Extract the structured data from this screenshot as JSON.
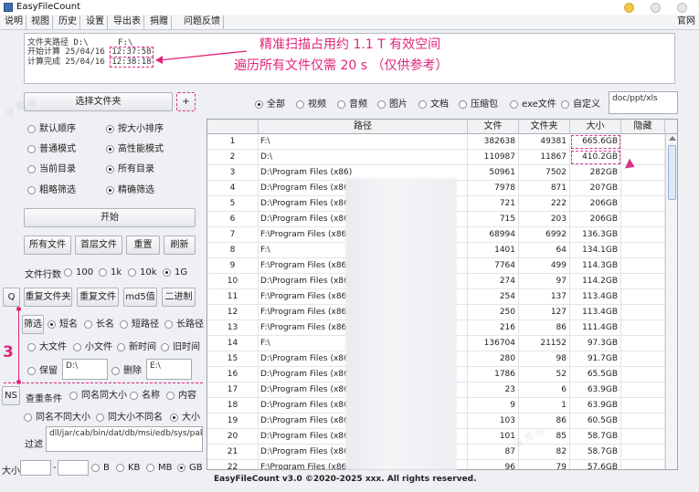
{
  "window": {
    "title": "EasyFileCount"
  },
  "menu": {
    "items": [
      "说明",
      "视图",
      "历史",
      "设置",
      "导出表",
      "捐赠",
      "问题反馈"
    ],
    "right": "官网"
  },
  "log": {
    "lines": [
      "文件夹路径 D:\\      F:\\",
      "开始计算 25/04/16",
      "计算完成 25/04/16"
    ],
    "start_time": "12:37:58",
    "end_time": "12:38:18"
  },
  "annotations": {
    "a1": "精准扫描占用约 1.1 T 有效空间",
    "a2": "遍历所有文件仅需 20 s （仅供参考）",
    "n1": "1",
    "n2": "2",
    "n3": "3"
  },
  "left": {
    "choose_folder": "选择文件夹",
    "add": "+",
    "sort_default": "默认顺序",
    "sort_size": "按大小排序",
    "mode_normal": "普通模式",
    "mode_high": "高性能模式",
    "dir_current": "当前目录",
    "dir_all": "所有目录",
    "filter_rough": "粗略筛选",
    "filter_exact": "精确筛选",
    "start": "开始",
    "btn_all_files": "所有文件",
    "btn_top_files": "首层文件",
    "btn_reset": "重置",
    "btn_refresh": "刷新",
    "rows_label": "文件行数",
    "rows_opts": [
      "100",
      "1k",
      "10k",
      "1G"
    ],
    "btn_q": "Q",
    "btn_dup_folder": "重复文件夹",
    "btn_dup_file": "重复文件",
    "btn_md5": "md5值",
    "btn_binary": "二进制",
    "btn_filter": "筛选",
    "f_short": "短名",
    "f_long": "长名",
    "f_shortpath": "短路径",
    "f_longpath": "长路径",
    "f_big": "大文件",
    "f_small": "小文件",
    "f_new": "新时间",
    "f_old": "旧时间",
    "keep_label": "保留",
    "keep_value": "D:\\",
    "del_label": "删除",
    "del_value": "E:\\",
    "btn_ns": "NS",
    "dup_cond": "查重条件",
    "c_same_name_size": "同名同大小",
    "c_name": "名称",
    "c_content": "内容",
    "c_same_name_diff": "同名不同大小",
    "c_same_size_diff": "同大小不同名",
    "c_size": "大小",
    "filter_label": "过滤",
    "filter_value": "dll/jar/cab/bin/dat/db/msi/edb/sys/pak/jsa",
    "size_label": "大小",
    "size_units": [
      "B",
      "KB",
      "MB",
      "GB"
    ]
  },
  "types": {
    "items": [
      "全部",
      "视频",
      "音频",
      "图片",
      "文档",
      "压缩包",
      "exe文件",
      "自定义"
    ],
    "custom_value": "doc/ppt/xls"
  },
  "table": {
    "headers": [
      "",
      "路径",
      "文件",
      "文件夹",
      "大小",
      "隐藏"
    ],
    "rows": [
      [
        "1",
        "F:\\",
        "382638",
        "49381",
        "665.6GB"
      ],
      [
        "2",
        "D:\\",
        "110987",
        "11867",
        "410.2GB"
      ],
      [
        "3",
        "D:\\Program Files (x86)",
        "50961",
        "7502",
        "282GB"
      ],
      [
        "4",
        "D:\\Program Files (x86)\\",
        "7978",
        "871",
        "207GB"
      ],
      [
        "5",
        "D:\\Program Files (x86)\\",
        "721",
        "222",
        "206GB"
      ],
      [
        "6",
        "D:\\Program Files (x86)\\",
        "715",
        "203",
        "206GB"
      ],
      [
        "7",
        "F:\\Program Files (x86)",
        "68994",
        "6992",
        "136.3GB"
      ],
      [
        "8",
        "F:\\",
        "1401",
        "64",
        "134.1GB"
      ],
      [
        "9",
        "F:\\Program Files (x86)\\",
        "7764",
        "499",
        "114.3GB"
      ],
      [
        "10",
        "D:\\Program Files (x86)\\",
        "274",
        "97",
        "114.2GB"
      ],
      [
        "11",
        "F:\\Program Files (x86)\\",
        "254",
        "137",
        "113.4GB"
      ],
      [
        "12",
        "F:\\Program Files (x86)\\",
        "250",
        "127",
        "113.4GB"
      ],
      [
        "13",
        "F:\\Program Files (x86)\\",
        "216",
        "86",
        "111.4GB"
      ],
      [
        "14",
        "F:\\",
        "136704",
        "21152",
        "97.3GB"
      ],
      [
        "15",
        "D:\\Program Files (x86)",
        "280",
        "98",
        "91.7GB"
      ],
      [
        "16",
        "D:\\Program Files (x86)\\",
        "1786",
        "52",
        "65.5GB"
      ],
      [
        "17",
        "D:\\Program Files (x86)\\",
        "23",
        "6",
        "63.9GB"
      ],
      [
        "18",
        "D:\\Program Files (x86)\\",
        "9",
        "1",
        "63.9GB"
      ],
      [
        "19",
        "D:\\Program Files (x86)\\",
        "103",
        "86",
        "60.5GB"
      ],
      [
        "20",
        "D:\\Program Files (x86)\\",
        "101",
        "85",
        "58.7GB"
      ],
      [
        "21",
        "D:\\Program Files (x86)\\",
        "87",
        "82",
        "58.7GB"
      ],
      [
        "22",
        "F:\\Program Files (x86)\\",
        "96",
        "79",
        "57.6GB"
      ],
      [
        "23",
        "F:\\Program Files (x86)\\",
        "94",
        "78",
        "55.9GB"
      ],
      [
        "24",
        "F:\\Program Files (x86)\\",
        "80",
        "75",
        "55.9GB"
      ]
    ]
  },
  "status": {
    "text": "EasyFileCount v3.0 ©2020-2025 xxx. All rights reserved."
  }
}
